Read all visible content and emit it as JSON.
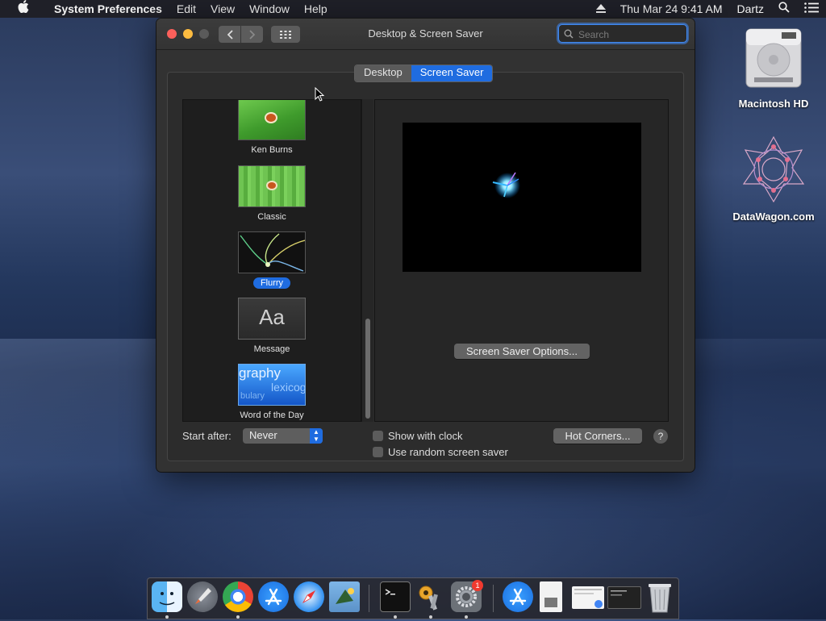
{
  "menubar": {
    "app_name": "System Preferences",
    "items": [
      "Edit",
      "View",
      "Window",
      "Help"
    ],
    "clock": "Thu Mar 24  9:41 AM",
    "user": "Dartz"
  },
  "window": {
    "title": "Desktop & Screen Saver",
    "search_placeholder": "Search",
    "tabs": [
      {
        "label": "Desktop",
        "active": false
      },
      {
        "label": "Screen Saver",
        "active": true
      }
    ]
  },
  "screensavers": [
    {
      "label": "Ken Burns",
      "selected": false
    },
    {
      "label": "Classic",
      "selected": false
    },
    {
      "label": "Flurry",
      "selected": true
    },
    {
      "label": "Message",
      "selected": false
    },
    {
      "label": "Word of the Day",
      "selected": false
    }
  ],
  "thumbs": {
    "message_text": "Aa",
    "word_lines": [
      "graphy",
      "lexicog",
      "bulary"
    ]
  },
  "controls": {
    "options_button": "Screen Saver Options...",
    "start_after_label": "Start after:",
    "start_after_value": "Never",
    "show_clock": "Show with clock",
    "random_saver": "Use random screen saver",
    "hot_corners": "Hot Corners...",
    "help": "?"
  },
  "desktop_icons": [
    {
      "label": "Macintosh HD",
      "icon": "hard-drive-icon"
    },
    {
      "label": "DataWagon.com",
      "icon": "geometric-star-icon"
    }
  ],
  "dock": {
    "apps": [
      "finder",
      "launchpad",
      "chrome",
      "app-store",
      "safari",
      "preview",
      "terminal",
      "keychain-access",
      "system-preferences",
      "app-store-download",
      "document",
      "chrome-window",
      "terminal-window",
      "trash"
    ],
    "system_prefs_badge": "1"
  }
}
